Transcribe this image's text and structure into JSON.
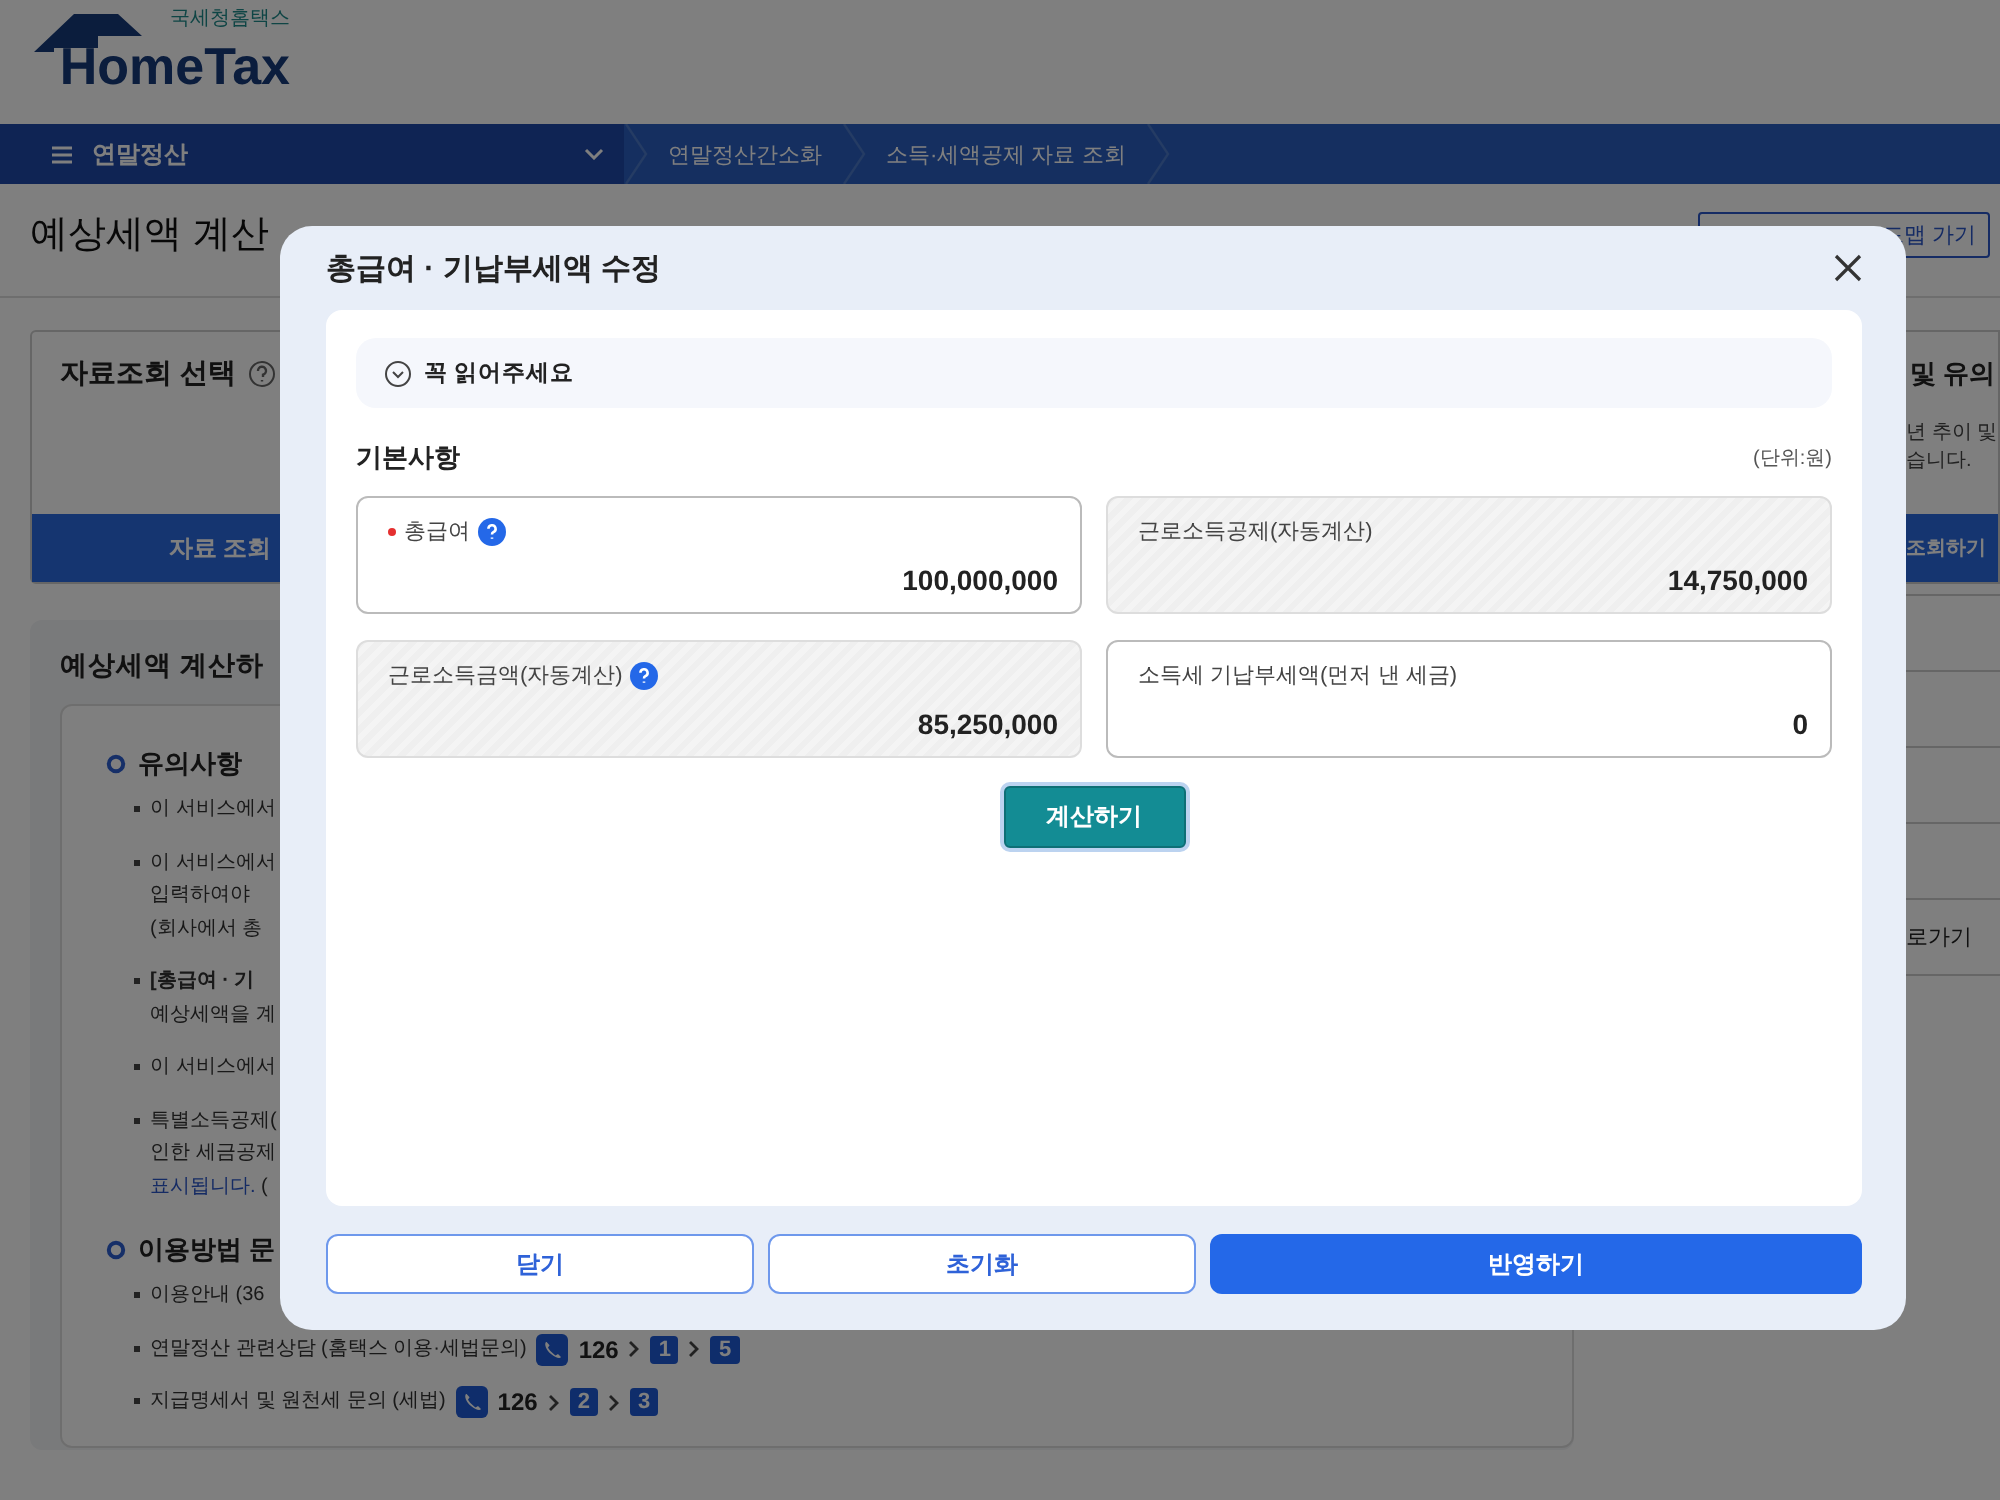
{
  "header": {
    "logo_caption": "국세청홈택스",
    "logo_name": "HomeTax"
  },
  "nav": {
    "menu_label": "연말정산",
    "breadcrumbs": [
      "연말정산간소화",
      "소득·세액공제 자료 조회"
    ]
  },
  "page": {
    "title": "예상세액 계산",
    "roadmap_button": "드맵 가기"
  },
  "left_card": {
    "title": "자료조회 선택",
    "button": "자료 조회"
  },
  "right_card": {
    "title": "및 유의",
    "lines": [
      "년 추이 및",
      "습니다."
    ],
    "button": "조회하기"
  },
  "right_links": [
    {
      "label": "로가기"
    }
  ],
  "section": {
    "title": "예상세액 계산하",
    "groups": [
      {
        "heading": "유의사항",
        "items": [
          {
            "lines": [
              "이 서비스에서"
            ]
          },
          {
            "lines": [
              "이 서비스에서",
              "입력하여야",
              "(회사에서 총"
            ]
          },
          {
            "lines": [
              "**[총급여 · 기**",
              "예상세액을 계"
            ]
          },
          {
            "lines": [
              "이 서비스에서"
            ]
          },
          {
            "lines": [
              "특별소득공제(",
              "인한 세금공제",
              {
                "link": "표시됩니다.",
                "rest": " ("
              }
            ]
          }
        ]
      },
      {
        "heading": "이용방법 문",
        "items": [
          {
            "lines": [
              "이용안내 (36"
            ]
          },
          {
            "lines": [
              "연말정산 관련상담 (홈택스 이용·세법문의)"
            ],
            "phone": "126",
            "keys": [
              "1",
              "5"
            ]
          },
          {
            "lines": [
              "지급명세서 및 원천세 문의 (세법)"
            ],
            "phone": "126",
            "keys": [
              "2",
              "3"
            ]
          }
        ]
      }
    ]
  },
  "dialog": {
    "title": "총급여 · 기납부세액 수정",
    "notice": "꼭 읽어주세요",
    "notice_expanded": false,
    "section_title": "기본사항",
    "unit": "(단위:원)",
    "fields": [
      {
        "label": "총급여",
        "value": "100,000,000",
        "kind": "input",
        "required": true,
        "help": true
      },
      {
        "label": "근로소득공제(자동계산)",
        "value": "14,750,000",
        "kind": "readonly",
        "required": false,
        "help": false
      },
      {
        "label": "근로소득금액(자동계산)",
        "value": "85,250,000",
        "kind": "readonly",
        "required": false,
        "help": true
      },
      {
        "label": "소득세 기납부세액(먼저 낸 세금)",
        "value": "0",
        "kind": "input",
        "required": false,
        "help": false
      }
    ],
    "calc_button": "계산하기",
    "buttons": [
      {
        "label": "닫기",
        "kind": "outline"
      },
      {
        "label": "초기화",
        "kind": "outline"
      },
      {
        "label": "반영하기",
        "kind": "primary"
      }
    ]
  }
}
